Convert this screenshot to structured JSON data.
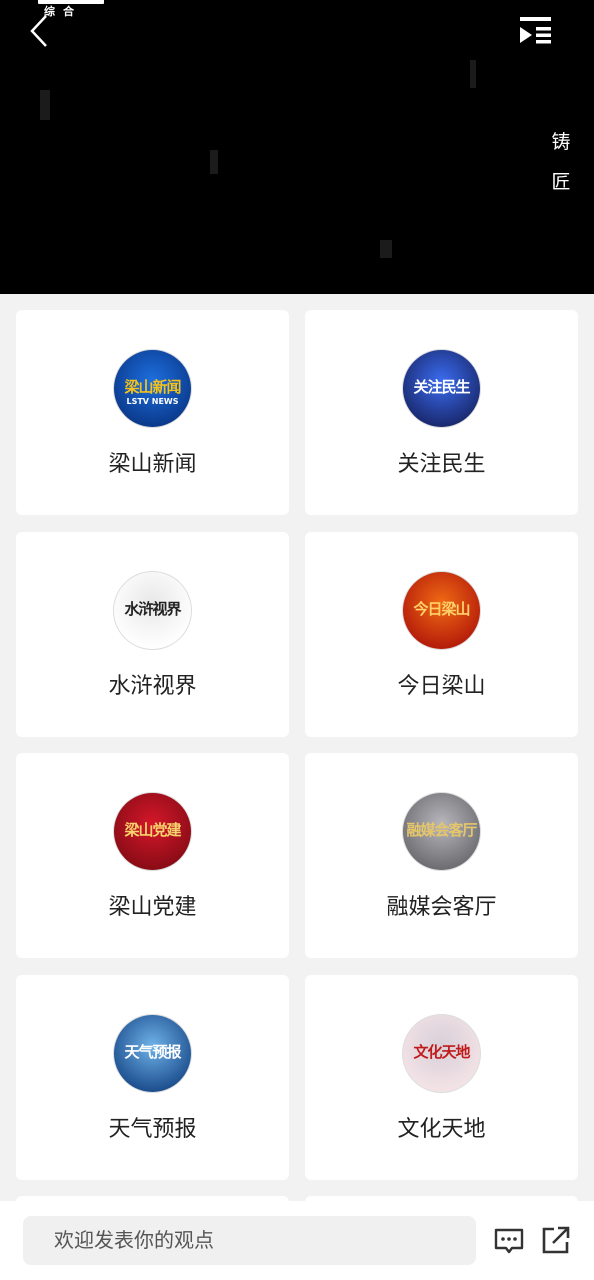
{
  "player": {
    "logo_text": "综合",
    "side_text": [
      "铸",
      "匠"
    ]
  },
  "channels": [
    {
      "label": "梁山新闻",
      "thumb_text": "梁山新闻",
      "thumb_sub": "LSTV NEWS",
      "colors": [
        "#0b3a8c",
        "#1d6fe0",
        "#f4c21a"
      ]
    },
    {
      "label": "关注民生",
      "thumb_text": "关注民生",
      "thumb_sub": "",
      "colors": [
        "#1a2a70",
        "#3b6cf0",
        "#ffffff"
      ]
    },
    {
      "label": "水浒视界",
      "thumb_text": "水浒视界",
      "thumb_sub": "",
      "colors": [
        "#ffffff",
        "#e8e8e8",
        "#222222"
      ]
    },
    {
      "label": "今日梁山",
      "thumb_text": "今日梁山",
      "thumb_sub": "",
      "colors": [
        "#b51d0a",
        "#f06a14",
        "#ffd36a"
      ]
    },
    {
      "label": "梁山党建",
      "thumb_text": "梁山党建",
      "thumb_sub": "",
      "colors": [
        "#8a0c16",
        "#d5172a",
        "#f7d36b"
      ]
    },
    {
      "label": "融媒会客厅",
      "thumb_text": "融媒会客厅",
      "thumb_sub": "",
      "colors": [
        "#6d6d72",
        "#b7b7bd",
        "#e6c66b"
      ]
    },
    {
      "label": "天气预报",
      "thumb_text": "天气预报",
      "thumb_sub": "",
      "colors": [
        "#1d4f8f",
        "#6fb2e8",
        "#ffffff"
      ]
    },
    {
      "label": "文化天地",
      "thumb_text": "文化天地",
      "thumb_sub": "",
      "colors": [
        "#f3e3e6",
        "#d7cfd8",
        "#c01a1a"
      ]
    }
  ],
  "comment_bar": {
    "placeholder": "欢迎发表你的观点"
  }
}
